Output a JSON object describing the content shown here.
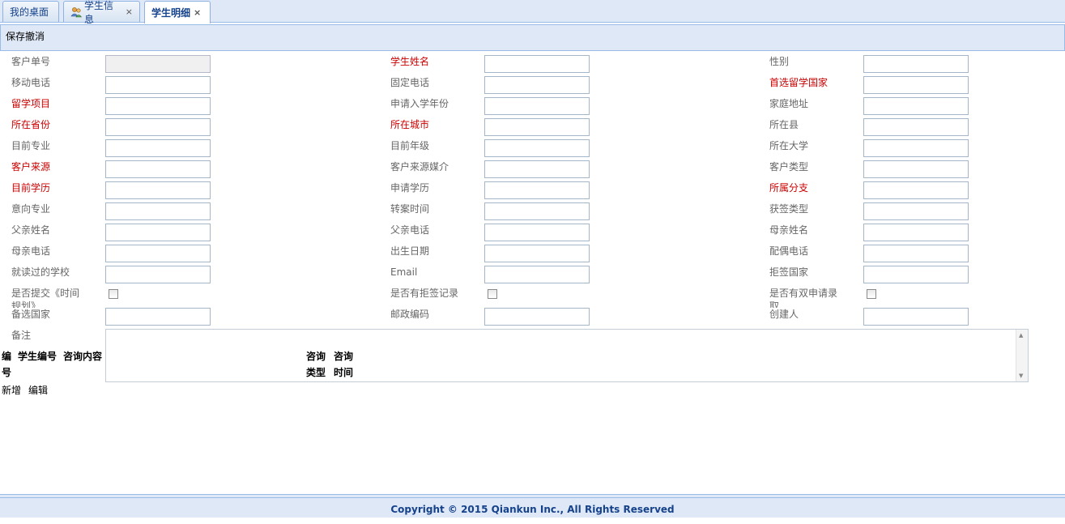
{
  "tabs": [
    {
      "label": "我的桌面",
      "closable": false,
      "icon": ""
    },
    {
      "label": "学生信息",
      "closable": true,
      "icon": "users-icon"
    },
    {
      "label": "学生明细",
      "closable": true,
      "icon": "",
      "active": true
    }
  ],
  "tab_close_glyph": "×",
  "toolbar": {
    "save": "保存",
    "cancel": "撤消"
  },
  "form": {
    "customer_no": "客户单号",
    "student_name": "学生姓名",
    "gender": "性别",
    "mobile": "移动电话",
    "phone": "固定电话",
    "preferred_country": "首选留学国家",
    "study_project": "留学项目",
    "enroll_year": "申请入学年份",
    "home_address": "家庭地址",
    "province": "所在省份",
    "city": "所在城市",
    "county": "所在县",
    "current_major": "目前专业",
    "current_grade": "目前年级",
    "university": "所在大学",
    "customer_source": "客户来源",
    "source_media": "客户来源媒介",
    "customer_type": "客户类型",
    "current_education": "目前学历",
    "applied_education": "申请学历",
    "branch": "所属分支",
    "intended_major": "意向专业",
    "transfer_time": "转案时间",
    "visa_type": "获签类型",
    "father_name": "父亲姓名",
    "father_phone": "父亲电话",
    "mother_name": "母亲姓名",
    "mother_phone": "母亲电话",
    "birth_date": "出生日期",
    "spouse_phone": "配偶电话",
    "school_attended": "就读过的学校",
    "email": "Email",
    "refused_country": "拒签国家",
    "submitted_plan": "是否提交《时间规划》",
    "has_refusal": "是否有拒签记录",
    "dual_application": "是否有双申请录取",
    "alt_country": "备选国家",
    "postal_code": "邮政编码",
    "creator": "创建人",
    "remark": "备注"
  },
  "consult_table": {
    "headers": [
      "编号",
      "学生编号",
      "咨询内容",
      "咨询类型",
      "咨询时间"
    ],
    "actions": [
      "新增",
      "编辑"
    ]
  },
  "footer": "Copyright © 2015 Qiankun Inc., All Rights Reserved"
}
